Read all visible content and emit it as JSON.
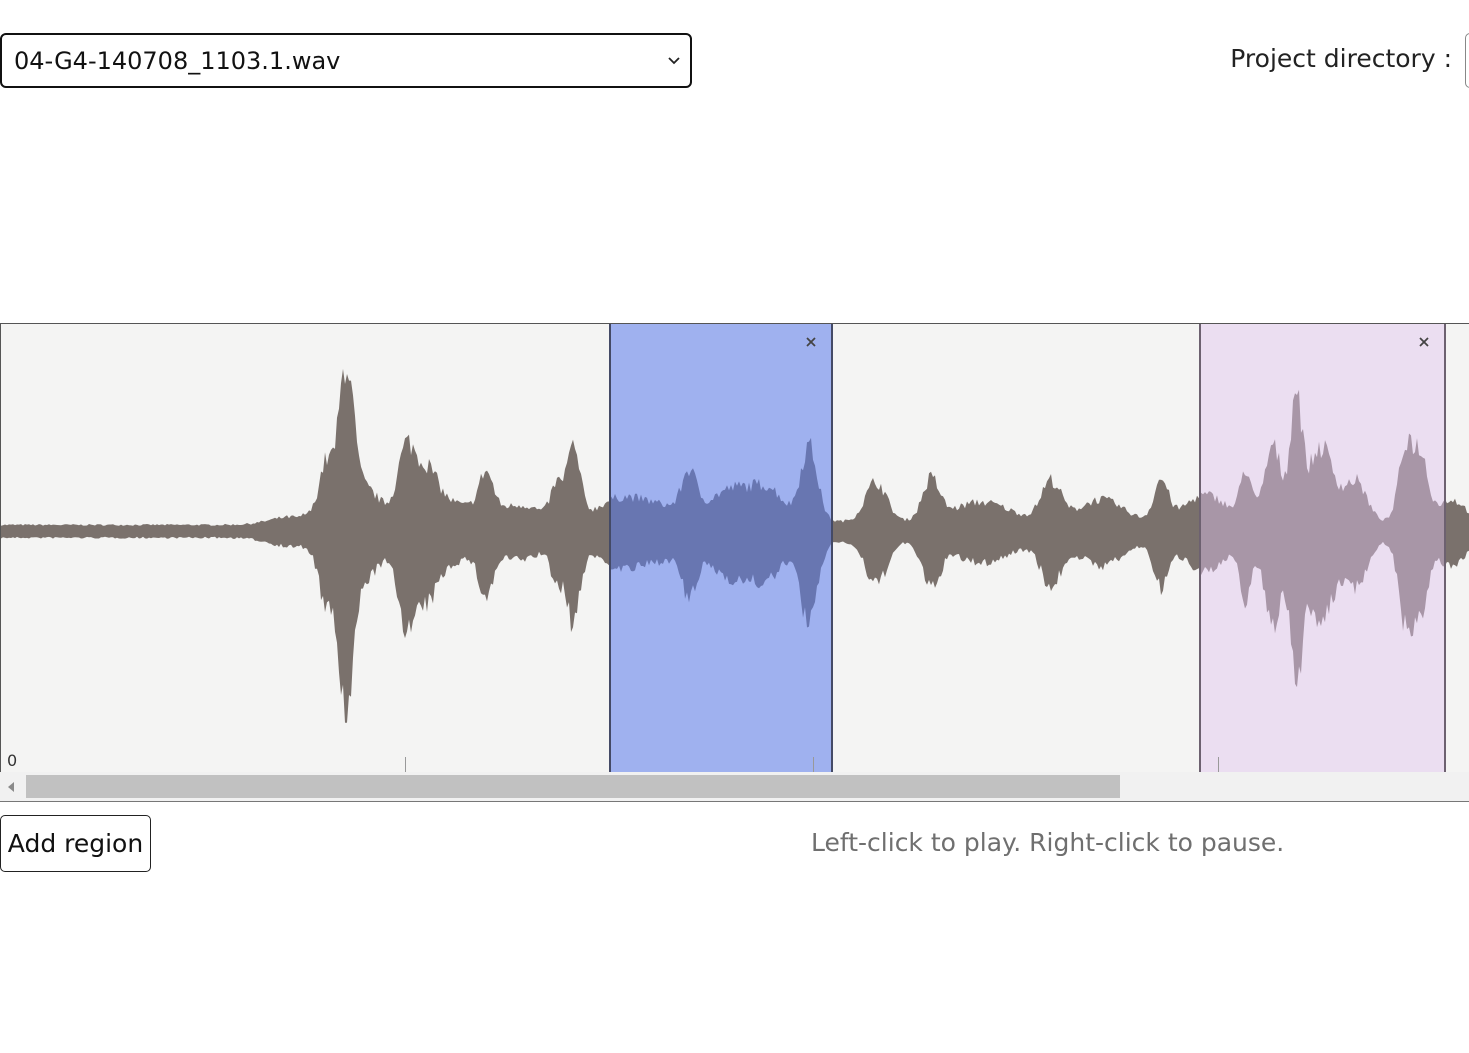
{
  "file_select": {
    "value": "04-G4-140708_1103.1.wav"
  },
  "project": {
    "label": "Project directory :"
  },
  "waveform": {
    "timeline_start_label": "0",
    "wave_color": "#7a716c",
    "background": "#f4f4f3",
    "regions": [
      {
        "color": "#8fa5f0",
        "close_icon": "close-icon"
      },
      {
        "color": "#eee0f5",
        "close_icon": "close-icon"
      }
    ]
  },
  "controls": {
    "add_region_label": "Add region",
    "hint": "Left-click to play. Right-click to pause."
  }
}
